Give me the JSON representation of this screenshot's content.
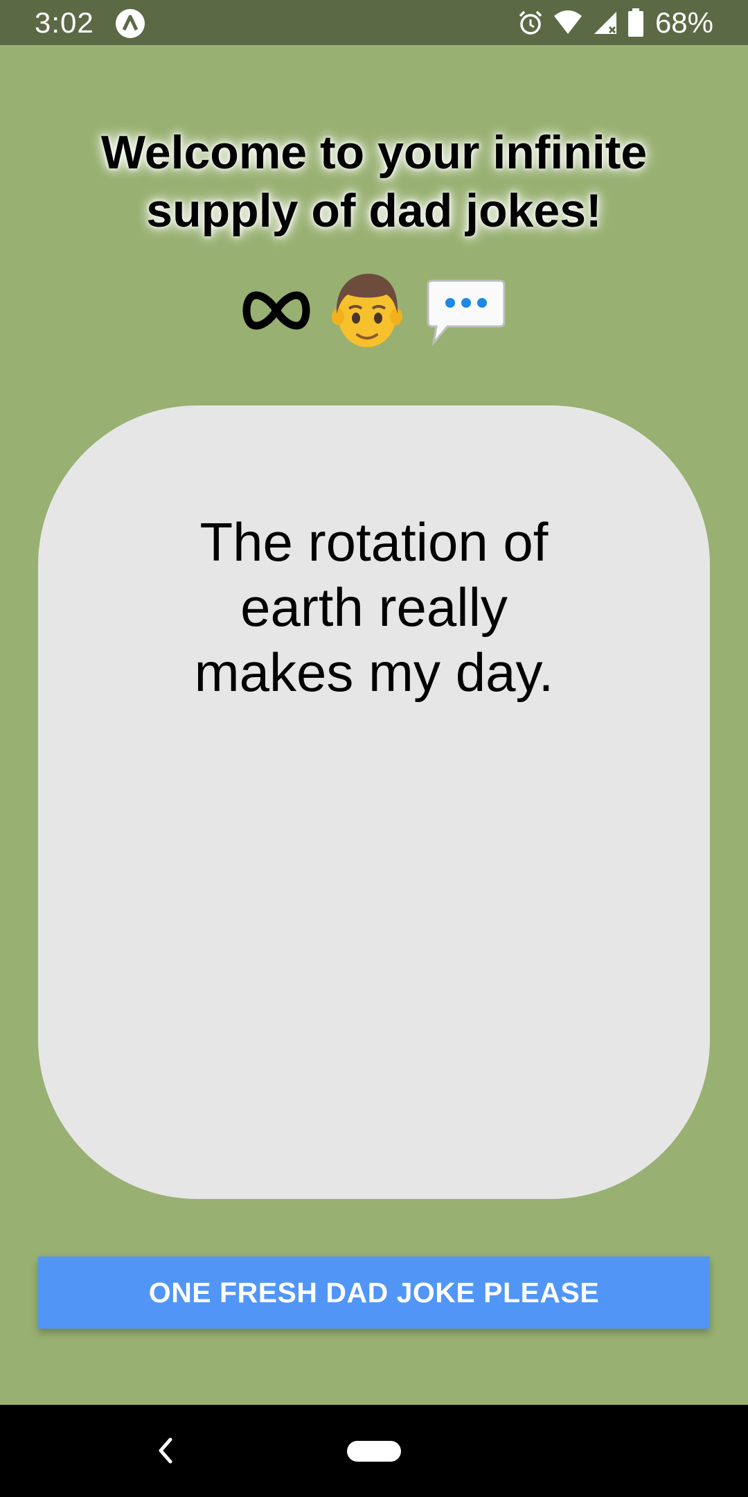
{
  "status_bar": {
    "time": "3:02",
    "battery_percent": "68%",
    "icons": [
      "app-notification-icon",
      "alarm-icon",
      "wifi-icon",
      "cell-signal-icon",
      "battery-icon"
    ]
  },
  "header": {
    "title": "Welcome to your infinite supply of dad jokes!",
    "emoji_icons": [
      "infinity-icon",
      "man-emoji-icon",
      "speech-bubble-icon"
    ]
  },
  "joke": {
    "text": "The rotation of earth really makes my day."
  },
  "button": {
    "label": "ONE FRESH DAD JOKE PLEASE"
  },
  "nav_bar": {
    "icons": [
      "back-icon",
      "home-pill"
    ]
  },
  "colors": {
    "background": "#98b071",
    "status_bar": "#5b6a45",
    "card": "#e6e6e6",
    "button": "#5196f7",
    "nav_bar": "#000000"
  }
}
